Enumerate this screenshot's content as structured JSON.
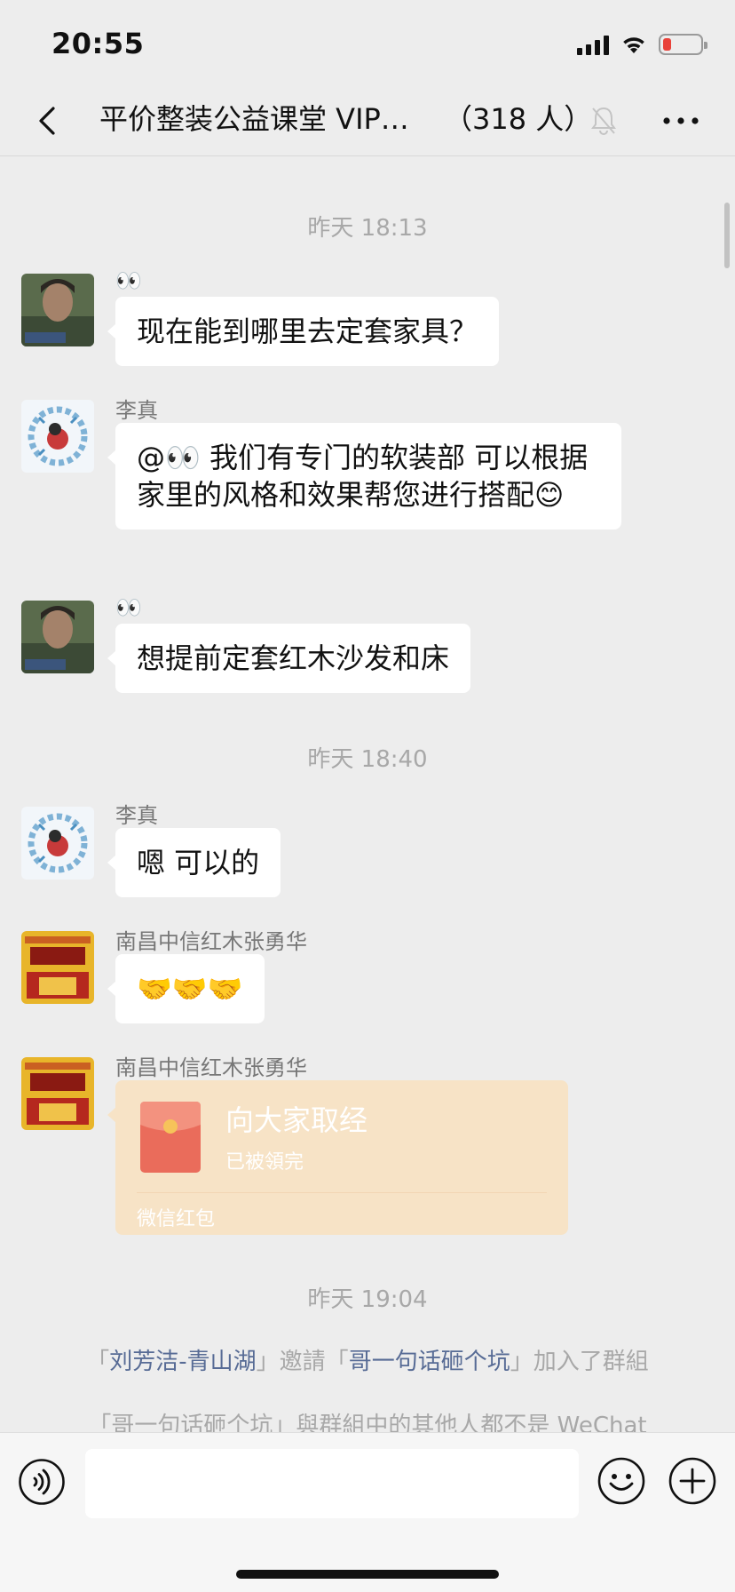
{
  "status_bar": {
    "time": "20:55",
    "icons": [
      "signal-icon",
      "wifi-icon",
      "battery-low-icon"
    ],
    "battery_color": "#e9423a"
  },
  "nav": {
    "title": "平价整装公益课堂 VIP…",
    "member_count": "（318 人）",
    "icons": [
      "back-chevron-icon",
      "mute-bell-icon",
      "more-dots-icon"
    ]
  },
  "messages": [
    {
      "type": "timestamp",
      "text": "昨天 18:13"
    },
    {
      "type": "text",
      "sender": "👀",
      "text": "现在能到哪里去定套家具？"
    },
    {
      "type": "text",
      "sender": "李真",
      "text": "@👀 我们有专门的软装部  可以根据家里的风格和效果帮您进行搭配😊"
    },
    {
      "type": "text",
      "sender": "👀",
      "text": "想提前定套红木沙发和床"
    },
    {
      "type": "timestamp",
      "text": "昨天 18:40"
    },
    {
      "type": "text",
      "sender": "李真",
      "text": "嗯 可以的"
    },
    {
      "type": "text",
      "sender": "南昌中信红木张勇华",
      "text": "🤝🤝🤝"
    },
    {
      "type": "red_packet",
      "sender": "南昌中信红木张勇华",
      "title": "向大家取经",
      "status": "已被領完",
      "footer": "微信红包"
    },
    {
      "type": "timestamp",
      "text": "昨天 19:04"
    },
    {
      "type": "system",
      "parts": {
        "open1": "「",
        "user1": "刘芳洁-青山湖",
        "mid": "」邀請「",
        "user2": "哥一句话砸个坑",
        "end": "」加入了群組"
      }
    },
    {
      "type": "system_plain",
      "text": "「哥一句话砸个坑」與群組中的其他人都不是 WeChat"
    }
  ],
  "input_bar": {
    "placeholder": "",
    "icons": [
      "voice-icon",
      "emoji-face-icon",
      "plus-icon"
    ]
  },
  "colors": {
    "background": "#ededed",
    "bubble": "#ffffff",
    "red_packet": "#f7e3c6",
    "link": "#576b95"
  }
}
